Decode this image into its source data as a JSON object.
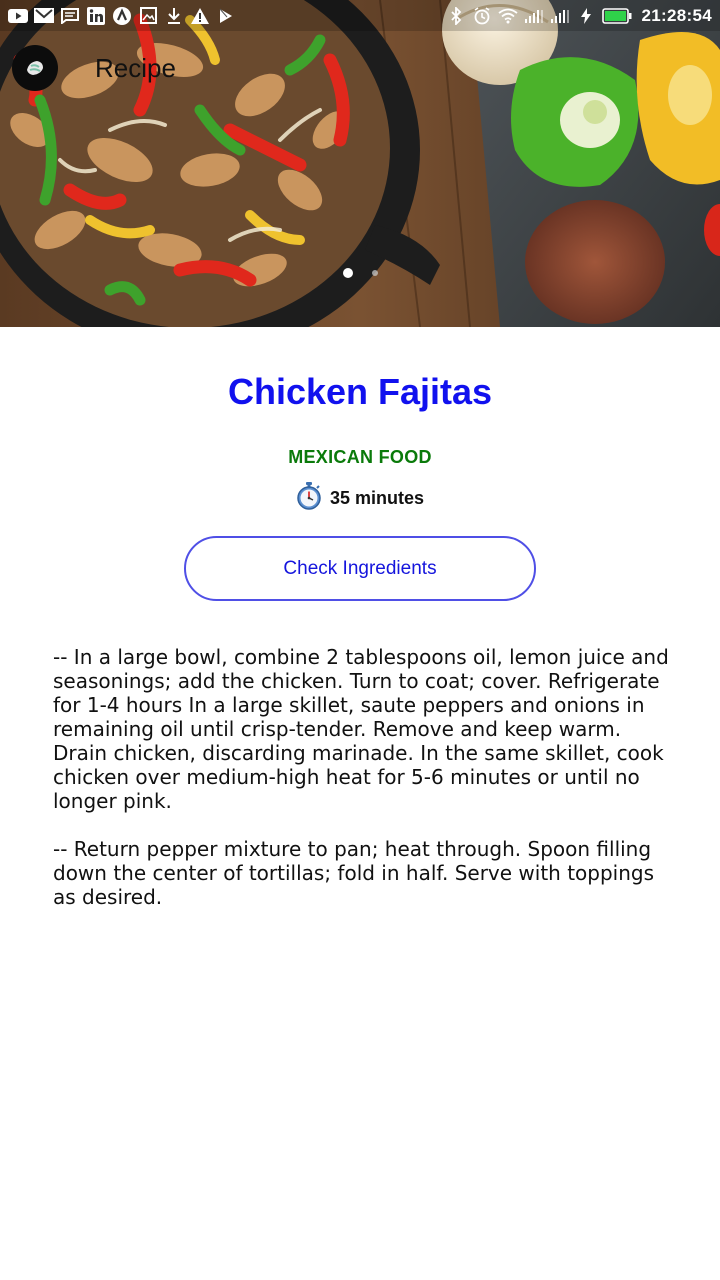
{
  "status_bar": {
    "time": "21:28:54",
    "left_icons": [
      "youtube-icon",
      "gmail-icon",
      "message-icon",
      "linkedin-icon",
      "app-a-icon",
      "gallery-icon",
      "download-icon",
      "warning-icon",
      "play-store-icon"
    ],
    "right_icons": [
      "bluetooth-icon",
      "alarm-icon",
      "wifi-icon",
      "signal-icon",
      "signal-icon",
      "charging-icon",
      "battery-icon"
    ],
    "battery_color": "#2fd24a"
  },
  "app_bar": {
    "title": "Recipe",
    "logo_icon": "fajita-logo-icon"
  },
  "hero": {
    "carousel_dots": 2,
    "active_dot": 0
  },
  "recipe": {
    "title": "Chicken Fajitas",
    "category": "MEXICAN FOOD",
    "duration": "35 minutes",
    "duration_icon": "stopwatch-icon",
    "ingredients_button": "Check Ingredients",
    "instructions": [
      "-- In a large bowl, combine 2 tablespoons oil, lemon juice and seasonings; add the chicken. Turn to coat; cover. Refrigerate for 1-4 hours In a large skillet, saute peppers and onions in remaining oil until crisp-tender. Remove and keep warm. Drain chicken, discarding marinade. In the same skillet, cook chicken over medium-high heat for 5-6 minutes or until no longer pink.",
      " -- Return pepper mixture to pan; heat through. Spoon filling down the center of tortillas; fold in half. Serve with toppings as desired."
    ]
  },
  "colors": {
    "title": "#1111ee",
    "category": "#0a7a0a",
    "button_border": "#4f4fe6",
    "button_text": "#1515dd"
  }
}
